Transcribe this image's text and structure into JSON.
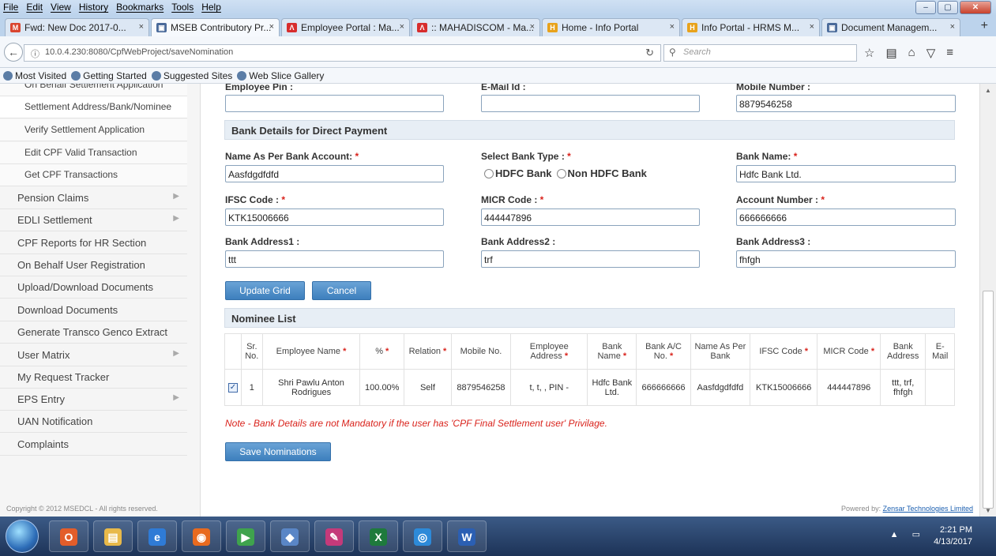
{
  "menu": [
    "File",
    "Edit",
    "View",
    "History",
    "Bookmarks",
    "Tools",
    "Help"
  ],
  "window_controls": {
    "minimize": "‒",
    "maximize": "▢",
    "close": "✕"
  },
  "tabs": [
    {
      "label": "Fwd: New Doc 2017-0...",
      "icon": "M",
      "color": "#d9452f"
    },
    {
      "label": "MSEB Contributory Pr...",
      "icon": "▣",
      "color": "#4a6a9a"
    },
    {
      "label": "Employee Portal : Ma...",
      "icon": "Λ",
      "color": "#d72d2d"
    },
    {
      "label": ":: MAHADISCOM - Ma...",
      "icon": "Λ",
      "color": "#d72d2d"
    },
    {
      "label": "Home - Info Portal",
      "icon": "H",
      "color": "#e8a21b"
    },
    {
      "label": "Info Portal - HRMS M...",
      "icon": "H",
      "color": "#e8a21b"
    },
    {
      "label": "Document Managem...",
      "icon": "▣",
      "color": "#4a6a9a"
    }
  ],
  "tab_close": "×",
  "new_tab": "+",
  "url": "10.0.4.230:8080/CpfWebProject/saveNomination",
  "search_placeholder": "Search",
  "bookmarks": [
    "Most Visited",
    "Getting Started",
    "Suggested Sites",
    "Web Slice Gallery"
  ],
  "sidebar": [
    {
      "label": "On Behalf Settlement Application",
      "sub": true,
      "arrow": false
    },
    {
      "label": "Settlement Address/Bank/Nominee",
      "sub": true,
      "arrow": false
    },
    {
      "label": "Verify Settlement Application",
      "sub": true,
      "arrow": false
    },
    {
      "label": "Edit CPF Valid Transaction",
      "sub": true,
      "arrow": false
    },
    {
      "label": "Get CPF Transactions",
      "sub": true,
      "arrow": false
    },
    {
      "label": "Pension Claims",
      "sub": false,
      "arrow": true
    },
    {
      "label": "EDLI Settlement",
      "sub": false,
      "arrow": true
    },
    {
      "label": "CPF Reports for HR Section",
      "sub": false,
      "arrow": false
    },
    {
      "label": "On Behalf User Registration",
      "sub": false,
      "arrow": false
    },
    {
      "label": "Upload/Download Documents",
      "sub": false,
      "arrow": false
    },
    {
      "label": "Download Documents",
      "sub": false,
      "arrow": false
    },
    {
      "label": "Generate Transco Genco Extract",
      "sub": false,
      "arrow": false
    },
    {
      "label": "User Matrix",
      "sub": false,
      "arrow": true
    },
    {
      "label": "My Request Tracker",
      "sub": false,
      "arrow": false
    },
    {
      "label": "EPS Entry",
      "sub": false,
      "arrow": true
    },
    {
      "label": "UAN Notification",
      "sub": false,
      "arrow": false
    },
    {
      "label": "Complaints",
      "sub": false,
      "arrow": false
    }
  ],
  "top_fields": {
    "employee_pin_label": "Employee Pin :",
    "email_label": "E-Mail Id :",
    "mobile_label": "Mobile Number :",
    "employee_pin": "",
    "email": "",
    "mobile": "8879546258"
  },
  "bank_section_title": "Bank Details for Direct Payment",
  "bank": {
    "name_label": "Name As Per Bank Account:",
    "name_value": "Aasfdgdfdfd",
    "type_label": "Select Bank Type :",
    "type_options": [
      "HDFC Bank",
      "Non HDFC Bank"
    ],
    "bank_name_label": "Bank Name:",
    "bank_name_value": "Hdfc Bank Ltd.",
    "ifsc_label": "IFSC Code :",
    "ifsc_value": "KTK15006666",
    "micr_label": "MICR Code :",
    "micr_value": "444447896",
    "account_label": "Account Number :",
    "account_value": "666666666",
    "addr1_label": "Bank Address1 :",
    "addr1_value": "ttt",
    "addr2_label": "Bank Address2 :",
    "addr2_value": "trf",
    "addr3_label": "Bank Address3 :",
    "addr3_value": "fhfgh"
  },
  "required_mark": "*",
  "buttons": {
    "update_grid": "Update Grid",
    "cancel": "Cancel",
    "save": "Save Nominations"
  },
  "nominee_title": "Nominee List",
  "nominee_columns": [
    "",
    "Sr. No.",
    "Employee Name",
    "%",
    "Relation",
    "Mobile No.",
    "Employee Address",
    "Bank Name",
    "Bank A/C No.",
    "Name As Per Bank",
    "IFSC Code",
    "MICR Code",
    "Bank Address",
    "E-Mail"
  ],
  "nominee_required": [
    false,
    false,
    true,
    true,
    true,
    false,
    true,
    true,
    true,
    false,
    true,
    true,
    false,
    false
  ],
  "nominee_rows": [
    {
      "checked": true,
      "cells": [
        "1",
        "Shri Pawlu Anton Rodrigues",
        "100.00%",
        "Self",
        "8879546258",
        "t, t, , PIN -",
        "Hdfc Bank Ltd.",
        "666666666",
        "Aasfdgdfdfd",
        "KTK15006666",
        "444447896",
        "ttt, trf, fhfgh",
        ""
      ]
    }
  ],
  "note": "Note - Bank Details are not Mandatory if the user has 'CPF Final Settlement user' Privilage.",
  "copyright": "Copyright © 2012 MSEDCL - All rights reserved.",
  "powered_by_prefix": "Powered by:",
  "powered_by_link": "Zensar Technologies Limited",
  "clock": {
    "time": "2:21 PM",
    "date": "4/13/2017"
  },
  "taskbar_apps": [
    {
      "name": "outlook",
      "glyph": "O",
      "color": "#e35d2a"
    },
    {
      "name": "explorer",
      "glyph": "▤",
      "color": "#e8b94a"
    },
    {
      "name": "ie",
      "glyph": "e",
      "color": "#2f7bd6"
    },
    {
      "name": "firefox",
      "glyph": "◉",
      "color": "#e86a1f"
    },
    {
      "name": "app5",
      "glyph": "▶",
      "color": "#3fa34d"
    },
    {
      "name": "app6",
      "glyph": "◆",
      "color": "#5a86c6"
    },
    {
      "name": "paint",
      "glyph": "✎",
      "color": "#c43a7a"
    },
    {
      "name": "excel",
      "glyph": "X",
      "color": "#1e7a3c"
    },
    {
      "name": "app9",
      "glyph": "◎",
      "color": "#2d8ad9"
    },
    {
      "name": "word",
      "glyph": "W",
      "color": "#2b5fb3"
    }
  ]
}
